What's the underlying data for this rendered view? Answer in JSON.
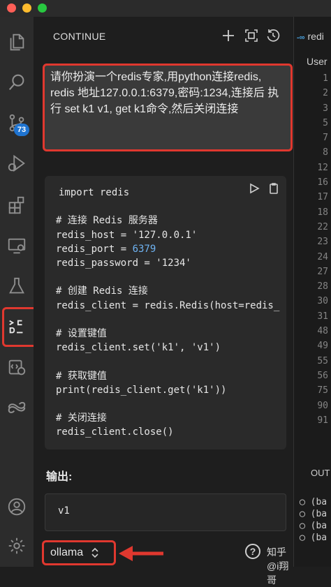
{
  "window": {
    "traffic_lights": [
      "#fe5f57",
      "#febc2e",
      "#28c840"
    ]
  },
  "activity_bar": {
    "items": [
      {
        "name": "explorer-icon"
      },
      {
        "name": "search-icon"
      },
      {
        "name": "source-control-icon",
        "badge": "73"
      },
      {
        "name": "run-debug-icon"
      },
      {
        "name": "extensions-icon"
      },
      {
        "name": "remote-explorer-icon"
      },
      {
        "name": "testing-icon"
      },
      {
        "name": "continue-icon",
        "label": ">C\nD_"
      },
      {
        "name": "cloud-code-icon"
      },
      {
        "name": "codegpt-icon"
      }
    ],
    "bottom": [
      {
        "name": "account-icon"
      },
      {
        "name": "settings-icon"
      }
    ],
    "highlight_color": "#e0382f"
  },
  "panel": {
    "title": "CONTINUE",
    "toolbar": [
      "plus-icon",
      "fullscreen-icon",
      "history-icon"
    ],
    "prompt": "请你扮演一个redis专家,用python连接redis, redis 地址127.0.0.1:6379,密码:1234,连接后 执行 set k1 v1, get k1命令,然后关闭连接",
    "code": {
      "lines": [
        "import redis",
        "",
        "# 连接 Redis 服务器",
        "redis_host = '127.0.0.1'",
        "redis_port = 6379",
        "redis_password = '1234'",
        "",
        "# 创建 Redis 连接",
        "redis_client = redis.Redis(host=redis_",
        "",
        "# 设置键值",
        "redis_client.set('k1', 'v1')",
        "",
        "# 获取键值",
        "print(redis_client.get('k1'))",
        "",
        "# 关闭连接",
        "redis_client.close()"
      ]
    },
    "output_label": "输出:",
    "output_value": "v1",
    "model": "ollama",
    "watermark": "知乎 @i翔哥"
  },
  "editor": {
    "tab": "redi",
    "breadcrumb": "User",
    "line_numbers": [
      "1",
      "2",
      "3",
      "5",
      "7",
      "8",
      "12",
      "16",
      "17",
      "18",
      "22",
      "23",
      "24",
      "27",
      "28",
      "30",
      "31",
      "48",
      "49",
      "55",
      "56",
      "75",
      "90",
      "91"
    ],
    "output_tab": "OUT",
    "terminal": [
      "(ba",
      "(ba",
      "(ba",
      "(ba"
    ]
  }
}
